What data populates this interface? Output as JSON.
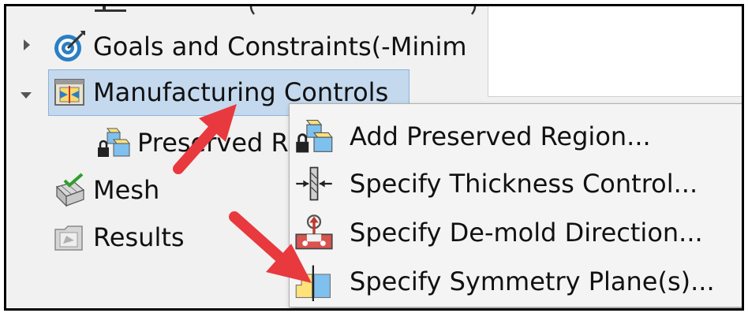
{
  "tree": {
    "cut_off_label": "",
    "items": [
      {
        "label": "Goals and Constraints(-Minim",
        "icon": "target-icon"
      },
      {
        "label": "Manufacturing Controls",
        "icon": "manufacturing-controls-icon"
      },
      {
        "label": "Preserved R",
        "icon": "preserved-region-icon"
      },
      {
        "label": "Mesh",
        "icon": "mesh-icon"
      },
      {
        "label": "Results",
        "icon": "results-icon"
      }
    ]
  },
  "context_menu": {
    "items": [
      {
        "label": "Add Preserved Region...",
        "icon": "preserved-region-icon"
      },
      {
        "label": "Specify Thickness Control...",
        "icon": "thickness-control-icon"
      },
      {
        "label": "Specify De-mold Direction...",
        "icon": "demold-direction-icon"
      },
      {
        "label": "Specify Symmetry Plane(s)...",
        "icon": "symmetry-plane-icon"
      }
    ]
  },
  "colors": {
    "selection": "#c4d9ee",
    "annotation_arrow": "#e8393e"
  }
}
